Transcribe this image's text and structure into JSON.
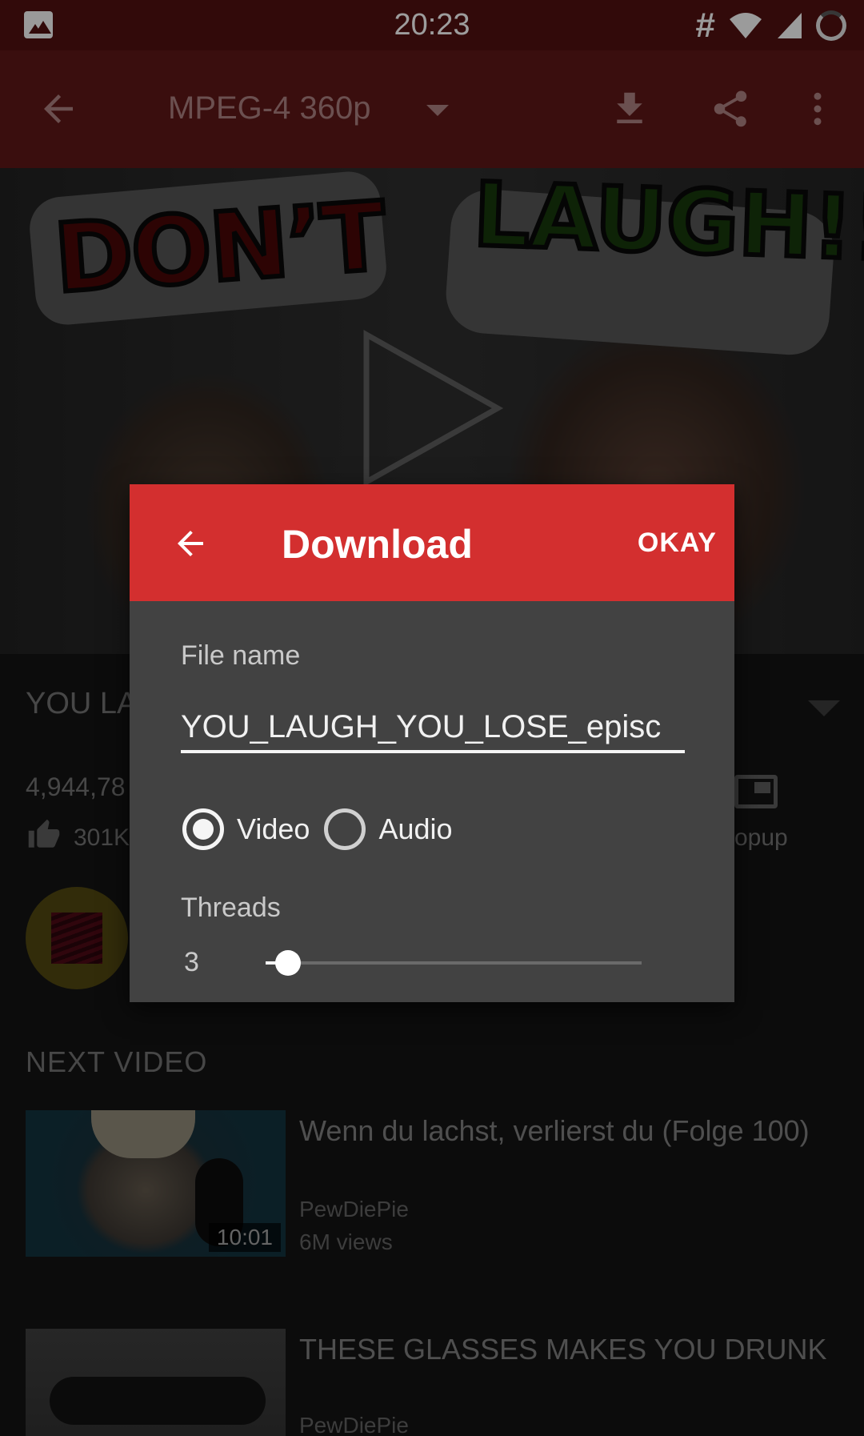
{
  "status_bar": {
    "time": "20:23",
    "left_icons": [
      "gallery-icon"
    ],
    "right_icons": [
      "hash-icon",
      "wifi-icon",
      "signal-icon",
      "battery-icon"
    ],
    "hash_glyph": "#"
  },
  "toolbar": {
    "quality": "MPEG-4 360p",
    "icons": [
      "back-arrow-icon",
      "dropdown-caret-icon",
      "download-icon",
      "share-icon",
      "more-vertical-icon"
    ]
  },
  "thumbnail": {
    "text_left": "DON’T",
    "text_right": "LAUGH!!",
    "icon": "play-icon"
  },
  "video_details": {
    "title_partial": "YOU LA",
    "views_partial": "4,944,78",
    "likes_partial": "301K",
    "popup_partial": "opup"
  },
  "next_video": {
    "header": "NEXT VIDEO",
    "items": [
      {
        "title": "Wenn du lachst, verlierst du (Folge 100)",
        "channel": "PewDiePie",
        "views": "6M views",
        "duration": "10:01"
      },
      {
        "title": "THESE GLASSES MAKES YOU DRUNK",
        "channel": "PewDiePie"
      }
    ]
  },
  "dialog": {
    "title": "Download",
    "okay_label": "OKAY",
    "file_name_label": "File name",
    "file_name_value": "YOU_LAUGH_YOU_LOSE_episc",
    "radio_video": "Video",
    "radio_audio": "Audio",
    "selected": "Video",
    "threads_label": "Threads",
    "threads_value": "3",
    "threads_slider_fraction": 0.06
  },
  "colors": {
    "dialog_header": "#d32f2f",
    "dialog_body": "#424242",
    "toolbar": "#5a1616",
    "status_bar": "#4d1010"
  }
}
